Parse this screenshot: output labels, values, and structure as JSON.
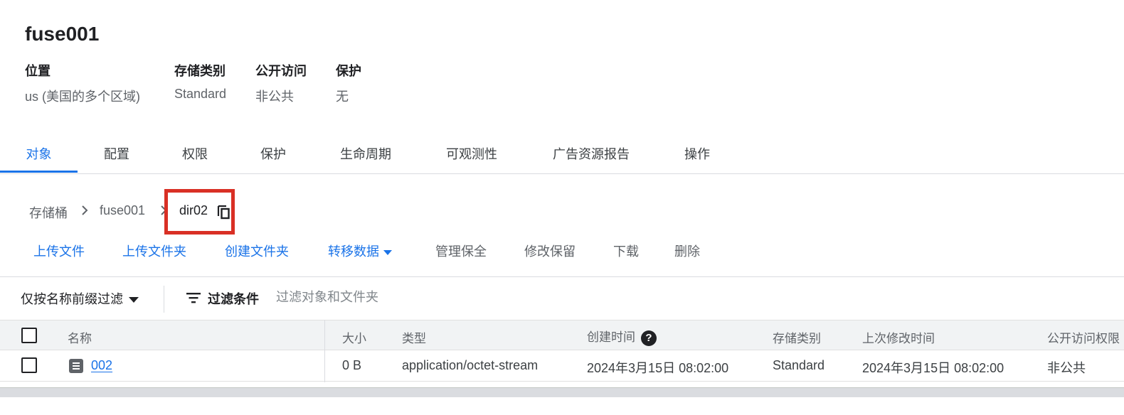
{
  "bucket": {
    "title": "fuse001",
    "meta": [
      {
        "label": "位置",
        "value": "us (美国的多个区域)"
      },
      {
        "label": "存储类别",
        "value": "Standard"
      },
      {
        "label": "公开访问",
        "value": "非公共"
      },
      {
        "label": "保护",
        "value": "无"
      }
    ]
  },
  "tabs": [
    {
      "label": "对象",
      "active": true
    },
    {
      "label": "配置"
    },
    {
      "label": "权限"
    },
    {
      "label": "保护"
    },
    {
      "label": "生命周期"
    },
    {
      "label": "可观测性"
    },
    {
      "label": "广告资源报告"
    },
    {
      "label": "操作"
    }
  ],
  "breadcrumb": {
    "items": [
      "存储桶",
      "fuse001",
      "dir02"
    ],
    "copy_icon": "copy-icon",
    "highlight_color": "#d93025"
  },
  "actions": [
    {
      "label": "上传文件",
      "style": "primary"
    },
    {
      "label": "上传文件夹",
      "style": "primary"
    },
    {
      "label": "创建文件夹",
      "style": "primary"
    },
    {
      "label": "转移数据",
      "style": "primary",
      "dropdown": true
    },
    {
      "label": "管理保全",
      "style": "disabled"
    },
    {
      "label": "修改保留",
      "style": "disabled"
    },
    {
      "label": "下载",
      "style": "disabled"
    },
    {
      "label": "删除",
      "style": "disabled"
    }
  ],
  "filter": {
    "prefix_label": "仅按名称前缀过滤",
    "filter_label": "过滤条件",
    "placeholder": "过滤对象和文件夹"
  },
  "table": {
    "columns": [
      "名称",
      "大小",
      "类型",
      "创建时间",
      "存储类别",
      "上次修改时间",
      "公开访问权限"
    ],
    "rows": [
      {
        "name": "002",
        "size": "0 B",
        "type": "application/octet-stream",
        "created": "2024年3月15日 08:02:00",
        "storage_class": "Standard",
        "modified": "2024年3月15日 08:02:00",
        "public_access": "非公共"
      }
    ]
  },
  "colors": {
    "accent": "#1a73e8",
    "highlight": "#d93025"
  }
}
